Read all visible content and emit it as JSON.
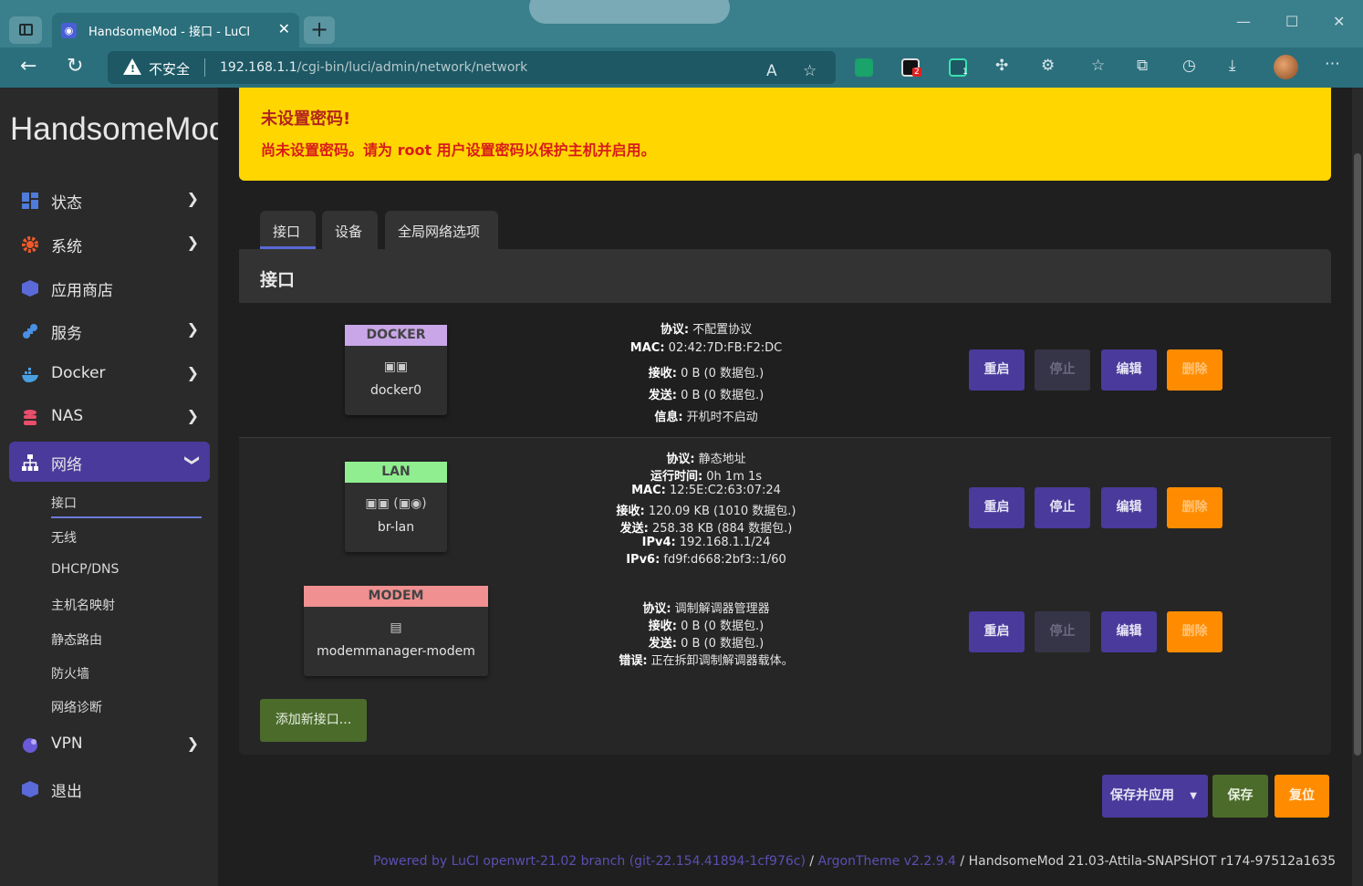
{
  "browser": {
    "tab_title": "HandsomeMod - 接口 - LuCI",
    "security_label": "不安全",
    "url_host": "192.168.1.1",
    "url_path": "/cgi-bin/luci/admin/network/network",
    "extension_badge_1": "2",
    "extension_badge_2": "1"
  },
  "sidebar": {
    "brand": "HandsomeMod",
    "items": [
      {
        "label": "状态",
        "icon": "dashboard-icon",
        "color": "#4f7bd9"
      },
      {
        "label": "系统",
        "icon": "gear-icon",
        "color": "#ef5a2a"
      },
      {
        "label": "应用商店",
        "icon": "box-icon",
        "color": "#5a6ad8"
      },
      {
        "label": "服务",
        "icon": "puzzle-icon",
        "color": "#4a90e2"
      },
      {
        "label": "Docker",
        "icon": "docker-icon",
        "color": "#4a9fe0"
      },
      {
        "label": "NAS",
        "icon": "database-icon",
        "color": "#e84e6a"
      },
      {
        "label": "网络",
        "icon": "sitemap-icon",
        "color": "#ffffff"
      },
      {
        "label": "VPN",
        "icon": "globe-icon",
        "color": "#6a5ad8"
      },
      {
        "label": "退出",
        "icon": "logout-icon",
        "color": "#5a6ad8"
      }
    ],
    "sub_items": [
      "接口",
      "无线",
      "DHCP/DNS",
      "主机名映射",
      "静态路由",
      "防火墙",
      "网络诊断"
    ]
  },
  "alert": {
    "title": "未设置密码!",
    "message": "尚未设置密码。请为 root 用户设置密码以保护主机并启用。"
  },
  "tabs": [
    "接口",
    "设备",
    "全局网络选项"
  ],
  "panel": {
    "title": "接口",
    "interfaces": [
      {
        "name": "DOCKER",
        "device": "docker0",
        "head_color": "#c9a6e8",
        "stats": [
          [
            "协议:",
            " 不配置协议"
          ],
          [
            "MAC:",
            " 02:42:7D:FB:F2:DC"
          ],
          [
            "接收:",
            " 0 B (0 数据包.)"
          ],
          [
            "发送:",
            " 0 B (0 数据包.)"
          ],
          [
            "信息:",
            " 开机时不启动"
          ]
        ]
      },
      {
        "name": "LAN",
        "device": "br-lan",
        "head_color": "#90ee90",
        "stats": [
          [
            "协议:",
            " 静态地址"
          ],
          [
            "运行时间:",
            " 0h 1m 1s"
          ],
          [
            "MAC:",
            " 12:5E:C2:63:07:24"
          ],
          [
            "接收:",
            " 120.09 KB (1010 数据包.)"
          ],
          [
            "发送:",
            " 258.38 KB (884 数据包.)"
          ],
          [
            "IPv4:",
            " 192.168.1.1/24"
          ],
          [
            "IPv6:",
            " fd9f:d668:2bf3::1/60"
          ]
        ]
      },
      {
        "name": "MODEM",
        "device": "modemmanager-modem",
        "head_color": "#f09090",
        "stats": [
          [
            "协议:",
            " 调制解调器管理器"
          ],
          [
            "接收:",
            " 0 B (0 数据包.)"
          ],
          [
            "发送:",
            " 0 B (0 数据包.)"
          ],
          [
            "错误:",
            " 正在拆卸调制解调器载体。"
          ]
        ]
      }
    ],
    "buttons": {
      "restart": "重启",
      "stop": "停止",
      "edit": "编辑",
      "delete": "删除"
    },
    "add_interface": "添加新接口..."
  },
  "actions": {
    "save_apply": "保存并应用",
    "save": "保存",
    "reset": "复位"
  },
  "footer": {
    "luci": "Powered by LuCI openwrt-21.02 branch (git-22.154.41894-1cf976c)",
    "sep1": " / ",
    "theme": "ArgonTheme v2.2.9.4",
    "sep2": " / ",
    "version": "HandsomeMod 21.03-Attila-SNAPSHOT r174-97512a1635"
  }
}
